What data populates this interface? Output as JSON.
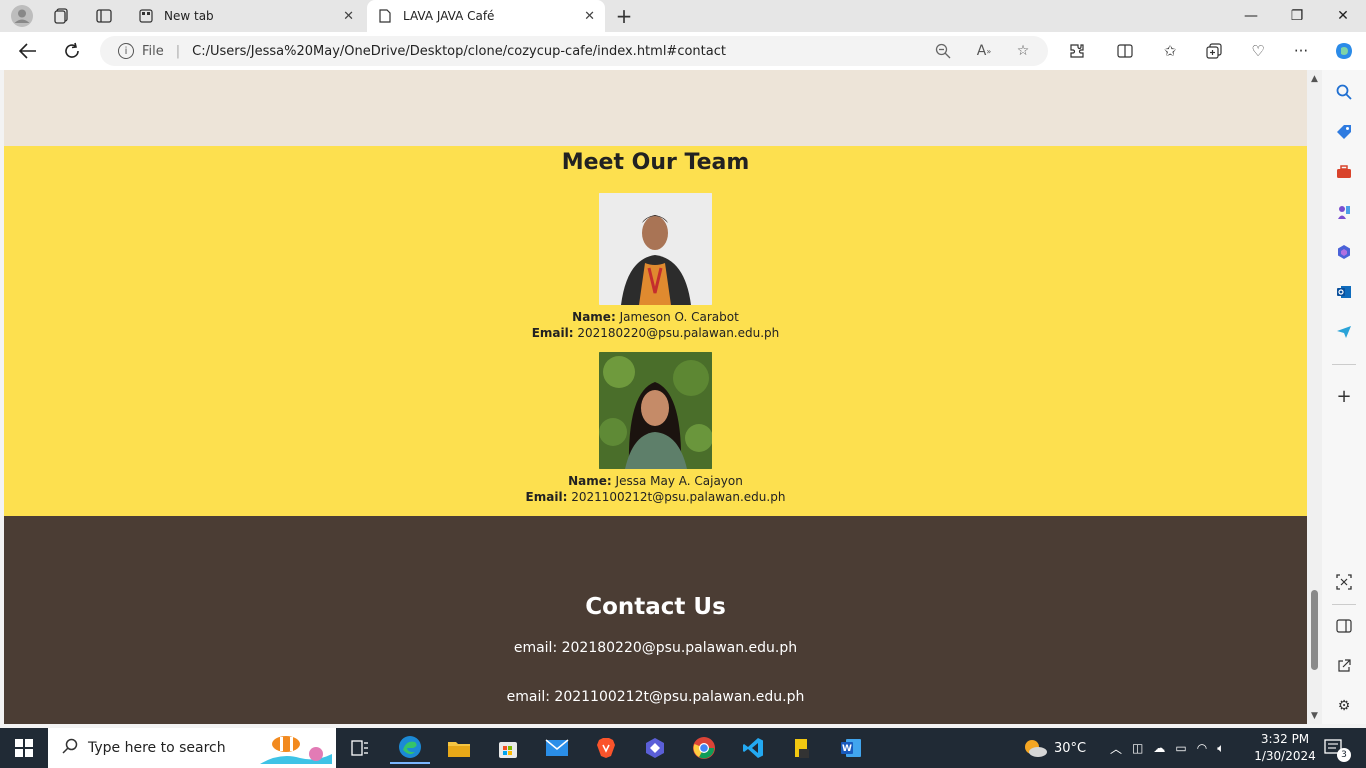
{
  "browser": {
    "tabs": [
      {
        "label": "New tab",
        "active": false
      },
      {
        "label": "LAVA JAVA Café",
        "active": true
      }
    ],
    "address": {
      "scheme_label": "File",
      "url": "C:/Users/Jessa%20May/OneDrive/Desktop/clone/cozycup-cafe/index.html#contact"
    }
  },
  "page": {
    "team": {
      "title": "Meet Our Team",
      "members": [
        {
          "name_label": "Name:",
          "name": "Jameson O. Carabot",
          "email_label": "Email:",
          "email": "202180220@psu.palawan.edu.ph"
        },
        {
          "name_label": "Name:",
          "name": "Jessa May A. Cajayon",
          "email_label": "Email:",
          "email": "2021100212t@psu.palawan.edu.ph"
        }
      ]
    },
    "contact": {
      "title": "Contact Us",
      "lines": [
        "email: 202180220@psu.palawan.edu.ph",
        "email: 2021100212t@psu.palawan.edu.ph"
      ]
    },
    "colors": {
      "top_section": "#ede4d8",
      "team_section": "#fde04f",
      "contact_section": "#4b3d34"
    }
  },
  "taskbar": {
    "search_placeholder": "Type here to search",
    "weather": "30°C",
    "time": "3:32 PM",
    "date": "1/30/2024",
    "notification_count": "3"
  }
}
